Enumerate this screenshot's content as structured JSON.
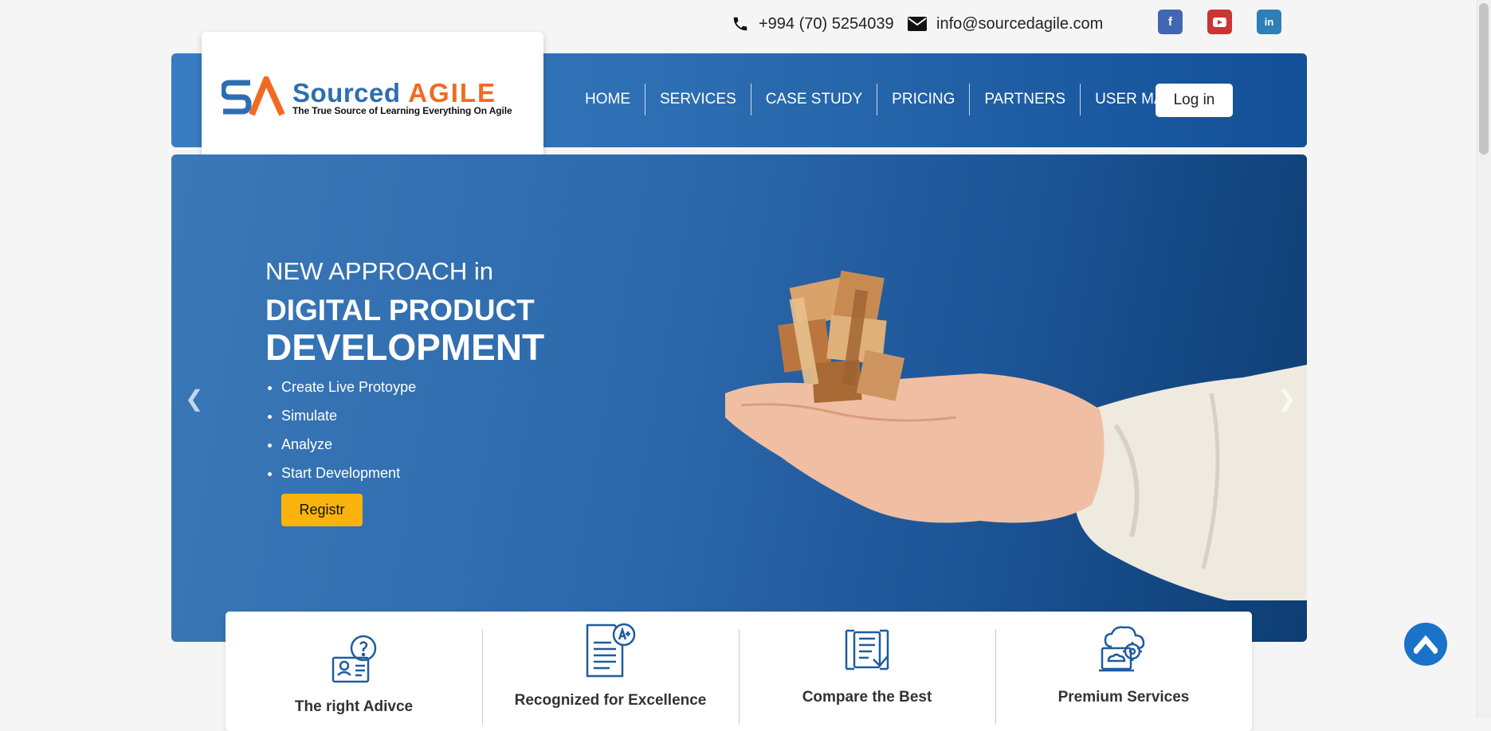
{
  "topbar": {
    "phone": "+994 (70) 5254039",
    "email": "info@sourcedagile.com"
  },
  "social": [
    {
      "icon": "facebook-icon",
      "glyph": "f",
      "color": "#4267b2"
    },
    {
      "icon": "youtube-icon",
      "glyph": "▶",
      "color": "#cc3333"
    },
    {
      "icon": "linkedin-icon",
      "glyph": "in",
      "color": "#2d7fb7"
    }
  ],
  "logo": {
    "mark": "SA",
    "name_part1": "Sourced",
    "name_part2": "AGILE",
    "tagline": "The True Source of Learning Everything On Agile"
  },
  "nav": {
    "items": [
      "HOME",
      "SERVICES",
      "CASE STUDY",
      "PRICING",
      "PARTNERS",
      "USER MANUAL"
    ],
    "login_label": "Log in"
  },
  "hero": {
    "subtitle": "NEW APPROACH in",
    "title_line1": "DIGITAL PRODUCT",
    "title_line2": "DEVELOPMENT",
    "bullets": [
      "Create Live Protoype",
      "Simulate",
      "Analyze",
      "Start Development"
    ],
    "button_label": "Registr"
  },
  "features": [
    {
      "title": "The right Adivce",
      "icon": "advice-icon"
    },
    {
      "title": "Recognized for Excellence",
      "icon": "certificate-icon"
    },
    {
      "title": "Compare the Best",
      "icon": "compare-icon"
    },
    {
      "title": "Premium Services",
      "icon": "cloud-service-icon"
    }
  ],
  "colors": {
    "brand_blue": "#2d6eb2",
    "brand_orange": "#f26a21",
    "cta_yellow": "#f9b30c"
  }
}
